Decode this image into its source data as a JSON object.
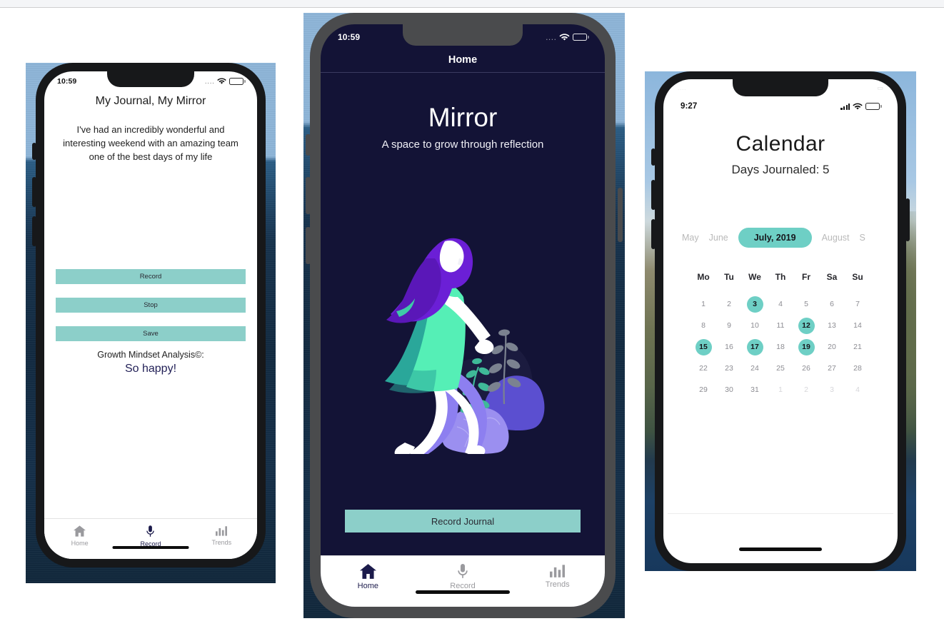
{
  "phones": [
    {
      "id": "journal-entry",
      "status": {
        "time": "10:59",
        "signal_dots": "....",
        "wifi": "wifi-icon",
        "battery": "battery-icon"
      },
      "screen_title": "My Journal, My Mirror",
      "entry_text": "I've had an incredibly wonderful and interesting weekend with an amazing team one of the best days of my life",
      "buttons": [
        {
          "label": "Record"
        },
        {
          "label": "Stop"
        },
        {
          "label": "Save"
        }
      ],
      "analysis_label": "Growth Mindset Analysis©:",
      "analysis_value": "So happy!",
      "tabs": [
        {
          "label": "Home",
          "icon": "home-icon",
          "active": false
        },
        {
          "label": "Record",
          "icon": "mic-icon",
          "active": true
        },
        {
          "label": "Trends",
          "icon": "chart-icon",
          "active": false
        }
      ]
    },
    {
      "id": "home-splash",
      "status": {
        "time": "10:59",
        "signal_dots": "....",
        "wifi": "wifi-icon",
        "battery": "battery-icon"
      },
      "nav_title": "Home",
      "hero_title": "Mirror",
      "hero_subtitle": "A space to grow through reflection",
      "illustration": "woman-walking-illustration",
      "cta_label": "Record Journal",
      "tabs": [
        {
          "label": "Home",
          "icon": "home-icon",
          "active": true
        },
        {
          "label": "Record",
          "icon": "mic-icon",
          "active": false
        },
        {
          "label": "Trends",
          "icon": "chart-icon",
          "active": false
        }
      ]
    },
    {
      "id": "calendar",
      "status": {
        "time": "9:27",
        "signal": "cellular-bars-icon",
        "wifi": "wifi-icon",
        "battery": "battery-icon"
      },
      "title": "Calendar",
      "subtitle": "Days Journaled: 5",
      "months": [
        {
          "label": "May",
          "active": false
        },
        {
          "label": "June",
          "active": false
        },
        {
          "label": "July, 2019",
          "active": true
        },
        {
          "label": "August",
          "active": false
        },
        {
          "label": "S",
          "active": false
        }
      ],
      "day_headers": [
        "Mo",
        "Tu",
        "We",
        "Th",
        "Fr",
        "Sa",
        "Su"
      ],
      "weeks": [
        [
          {
            "d": "1"
          },
          {
            "d": "2"
          },
          {
            "d": "3",
            "marked": true
          },
          {
            "d": "4"
          },
          {
            "d": "5"
          },
          {
            "d": "6"
          },
          {
            "d": "7"
          }
        ],
        [
          {
            "d": "8"
          },
          {
            "d": "9"
          },
          {
            "d": "10"
          },
          {
            "d": "11"
          },
          {
            "d": "12",
            "marked": true
          },
          {
            "d": "13"
          },
          {
            "d": "14"
          }
        ],
        [
          {
            "d": "15",
            "marked": true
          },
          {
            "d": "16"
          },
          {
            "d": "17",
            "marked": true
          },
          {
            "d": "18"
          },
          {
            "d": "19",
            "marked": true
          },
          {
            "d": "20"
          },
          {
            "d": "21"
          }
        ],
        [
          {
            "d": "22"
          },
          {
            "d": "23"
          },
          {
            "d": "24"
          },
          {
            "d": "25"
          },
          {
            "d": "26"
          },
          {
            "d": "27"
          },
          {
            "d": "28"
          }
        ],
        [
          {
            "d": "29"
          },
          {
            "d": "30"
          },
          {
            "d": "31"
          },
          {
            "d": "1",
            "muted": true
          },
          {
            "d": "2",
            "muted": true
          },
          {
            "d": "3",
            "muted": true
          },
          {
            "d": "4",
            "muted": true
          }
        ]
      ],
      "journaled_days": [
        3,
        12,
        15,
        17,
        19
      ],
      "journaled_count": 5
    }
  ],
  "colors": {
    "teal_button": "#8ccfc9",
    "teal_accent": "#6ecfc5",
    "navy_screen": "#131336",
    "navy_text": "#211f56",
    "frame_black": "#17181a",
    "frame_gray": "#4a4b4d"
  }
}
